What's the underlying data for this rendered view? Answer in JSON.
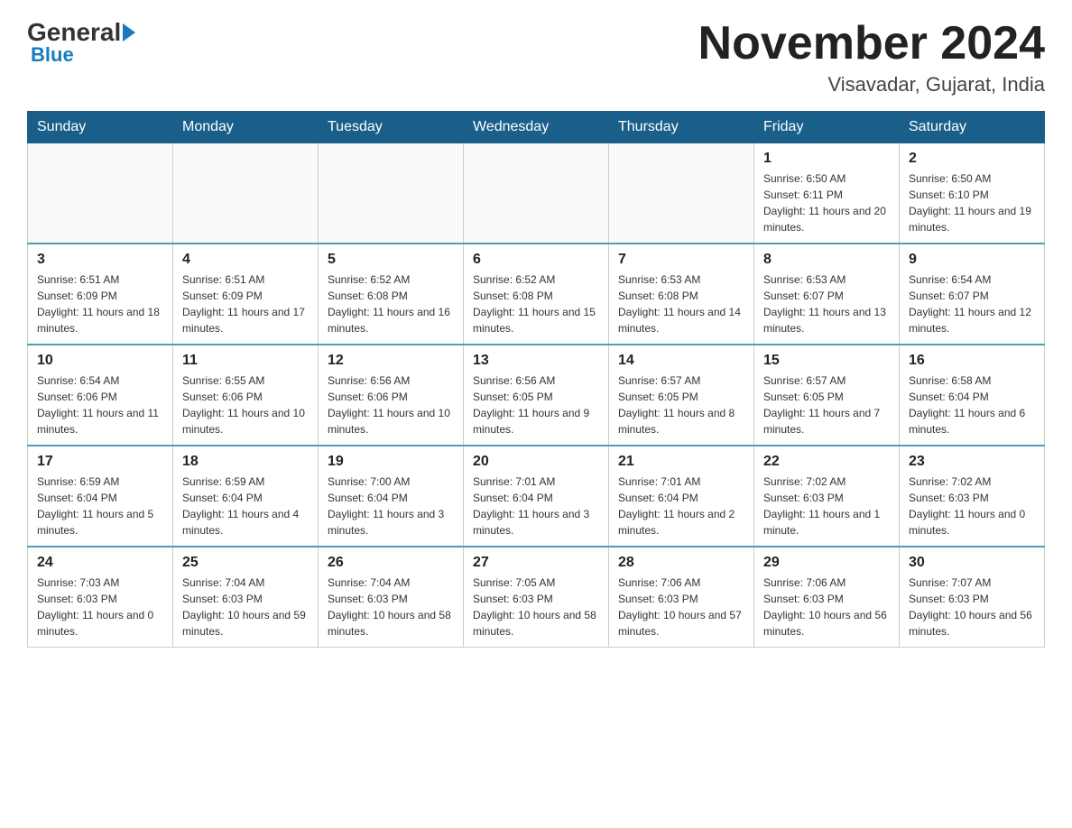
{
  "header": {
    "logo_text": "General",
    "logo_blue": "Blue",
    "month_title": "November 2024",
    "location": "Visavadar, Gujarat, India"
  },
  "days_of_week": [
    "Sunday",
    "Monday",
    "Tuesday",
    "Wednesday",
    "Thursday",
    "Friday",
    "Saturday"
  ],
  "weeks": [
    [
      {
        "day": "",
        "sunrise": "",
        "sunset": "",
        "daylight": ""
      },
      {
        "day": "",
        "sunrise": "",
        "sunset": "",
        "daylight": ""
      },
      {
        "day": "",
        "sunrise": "",
        "sunset": "",
        "daylight": ""
      },
      {
        "day": "",
        "sunrise": "",
        "sunset": "",
        "daylight": ""
      },
      {
        "day": "",
        "sunrise": "",
        "sunset": "",
        "daylight": ""
      },
      {
        "day": "1",
        "sunrise": "Sunrise: 6:50 AM",
        "sunset": "Sunset: 6:11 PM",
        "daylight": "Daylight: 11 hours and 20 minutes."
      },
      {
        "day": "2",
        "sunrise": "Sunrise: 6:50 AM",
        "sunset": "Sunset: 6:10 PM",
        "daylight": "Daylight: 11 hours and 19 minutes."
      }
    ],
    [
      {
        "day": "3",
        "sunrise": "Sunrise: 6:51 AM",
        "sunset": "Sunset: 6:09 PM",
        "daylight": "Daylight: 11 hours and 18 minutes."
      },
      {
        "day": "4",
        "sunrise": "Sunrise: 6:51 AM",
        "sunset": "Sunset: 6:09 PM",
        "daylight": "Daylight: 11 hours and 17 minutes."
      },
      {
        "day": "5",
        "sunrise": "Sunrise: 6:52 AM",
        "sunset": "Sunset: 6:08 PM",
        "daylight": "Daylight: 11 hours and 16 minutes."
      },
      {
        "day": "6",
        "sunrise": "Sunrise: 6:52 AM",
        "sunset": "Sunset: 6:08 PM",
        "daylight": "Daylight: 11 hours and 15 minutes."
      },
      {
        "day": "7",
        "sunrise": "Sunrise: 6:53 AM",
        "sunset": "Sunset: 6:08 PM",
        "daylight": "Daylight: 11 hours and 14 minutes."
      },
      {
        "day": "8",
        "sunrise": "Sunrise: 6:53 AM",
        "sunset": "Sunset: 6:07 PM",
        "daylight": "Daylight: 11 hours and 13 minutes."
      },
      {
        "day": "9",
        "sunrise": "Sunrise: 6:54 AM",
        "sunset": "Sunset: 6:07 PM",
        "daylight": "Daylight: 11 hours and 12 minutes."
      }
    ],
    [
      {
        "day": "10",
        "sunrise": "Sunrise: 6:54 AM",
        "sunset": "Sunset: 6:06 PM",
        "daylight": "Daylight: 11 hours and 11 minutes."
      },
      {
        "day": "11",
        "sunrise": "Sunrise: 6:55 AM",
        "sunset": "Sunset: 6:06 PM",
        "daylight": "Daylight: 11 hours and 10 minutes."
      },
      {
        "day": "12",
        "sunrise": "Sunrise: 6:56 AM",
        "sunset": "Sunset: 6:06 PM",
        "daylight": "Daylight: 11 hours and 10 minutes."
      },
      {
        "day": "13",
        "sunrise": "Sunrise: 6:56 AM",
        "sunset": "Sunset: 6:05 PM",
        "daylight": "Daylight: 11 hours and 9 minutes."
      },
      {
        "day": "14",
        "sunrise": "Sunrise: 6:57 AM",
        "sunset": "Sunset: 6:05 PM",
        "daylight": "Daylight: 11 hours and 8 minutes."
      },
      {
        "day": "15",
        "sunrise": "Sunrise: 6:57 AM",
        "sunset": "Sunset: 6:05 PM",
        "daylight": "Daylight: 11 hours and 7 minutes."
      },
      {
        "day": "16",
        "sunrise": "Sunrise: 6:58 AM",
        "sunset": "Sunset: 6:04 PM",
        "daylight": "Daylight: 11 hours and 6 minutes."
      }
    ],
    [
      {
        "day": "17",
        "sunrise": "Sunrise: 6:59 AM",
        "sunset": "Sunset: 6:04 PM",
        "daylight": "Daylight: 11 hours and 5 minutes."
      },
      {
        "day": "18",
        "sunrise": "Sunrise: 6:59 AM",
        "sunset": "Sunset: 6:04 PM",
        "daylight": "Daylight: 11 hours and 4 minutes."
      },
      {
        "day": "19",
        "sunrise": "Sunrise: 7:00 AM",
        "sunset": "Sunset: 6:04 PM",
        "daylight": "Daylight: 11 hours and 3 minutes."
      },
      {
        "day": "20",
        "sunrise": "Sunrise: 7:01 AM",
        "sunset": "Sunset: 6:04 PM",
        "daylight": "Daylight: 11 hours and 3 minutes."
      },
      {
        "day": "21",
        "sunrise": "Sunrise: 7:01 AM",
        "sunset": "Sunset: 6:04 PM",
        "daylight": "Daylight: 11 hours and 2 minutes."
      },
      {
        "day": "22",
        "sunrise": "Sunrise: 7:02 AM",
        "sunset": "Sunset: 6:03 PM",
        "daylight": "Daylight: 11 hours and 1 minute."
      },
      {
        "day": "23",
        "sunrise": "Sunrise: 7:02 AM",
        "sunset": "Sunset: 6:03 PM",
        "daylight": "Daylight: 11 hours and 0 minutes."
      }
    ],
    [
      {
        "day": "24",
        "sunrise": "Sunrise: 7:03 AM",
        "sunset": "Sunset: 6:03 PM",
        "daylight": "Daylight: 11 hours and 0 minutes."
      },
      {
        "day": "25",
        "sunrise": "Sunrise: 7:04 AM",
        "sunset": "Sunset: 6:03 PM",
        "daylight": "Daylight: 10 hours and 59 minutes."
      },
      {
        "day": "26",
        "sunrise": "Sunrise: 7:04 AM",
        "sunset": "Sunset: 6:03 PM",
        "daylight": "Daylight: 10 hours and 58 minutes."
      },
      {
        "day": "27",
        "sunrise": "Sunrise: 7:05 AM",
        "sunset": "Sunset: 6:03 PM",
        "daylight": "Daylight: 10 hours and 58 minutes."
      },
      {
        "day": "28",
        "sunrise": "Sunrise: 7:06 AM",
        "sunset": "Sunset: 6:03 PM",
        "daylight": "Daylight: 10 hours and 57 minutes."
      },
      {
        "day": "29",
        "sunrise": "Sunrise: 7:06 AM",
        "sunset": "Sunset: 6:03 PM",
        "daylight": "Daylight: 10 hours and 56 minutes."
      },
      {
        "day": "30",
        "sunrise": "Sunrise: 7:07 AM",
        "sunset": "Sunset: 6:03 PM",
        "daylight": "Daylight: 10 hours and 56 minutes."
      }
    ]
  ]
}
